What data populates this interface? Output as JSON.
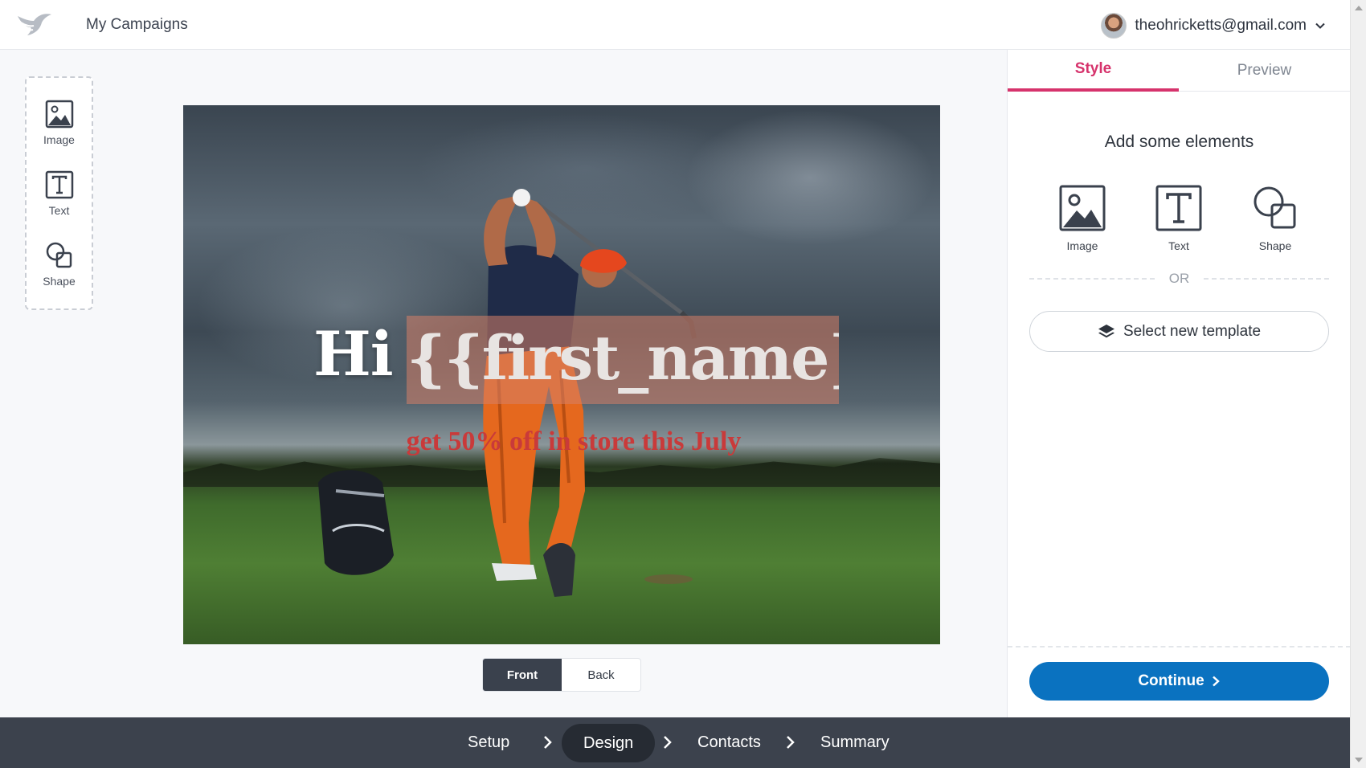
{
  "header": {
    "nav_title": "My Campaigns",
    "user_email": "theohricketts@gmail.com"
  },
  "toolbox": {
    "items": [
      {
        "label": "Image",
        "icon": "image-icon"
      },
      {
        "label": "Text",
        "icon": "text-icon"
      },
      {
        "label": "Shape",
        "icon": "shape-icon"
      }
    ]
  },
  "canvas": {
    "greeting": "Hi",
    "name_placeholder": "{{first_name}}",
    "subtitle": "get 50% off in store this July",
    "subtitle_color": "#c93a3a"
  },
  "sides": {
    "front_label": "Front",
    "back_label": "Back",
    "active": "Front"
  },
  "panel": {
    "tabs": [
      {
        "label": "Style",
        "active": true
      },
      {
        "label": "Preview",
        "active": false
      }
    ],
    "heading": "Add some elements",
    "elements": [
      {
        "label": "Image",
        "icon": "image-icon"
      },
      {
        "label": "Text",
        "icon": "text-icon"
      },
      {
        "label": "Shape",
        "icon": "shape-icon"
      }
    ],
    "or_label": "OR",
    "template_label": "Select new template",
    "continue_label": "Continue",
    "accent_color": "#d6336c",
    "primary_color": "#0a72c0"
  },
  "steps": {
    "items": [
      {
        "label": "Setup",
        "active": false
      },
      {
        "label": "Design",
        "active": true
      },
      {
        "label": "Contacts",
        "active": false
      },
      {
        "label": "Summary",
        "active": false
      }
    ]
  }
}
